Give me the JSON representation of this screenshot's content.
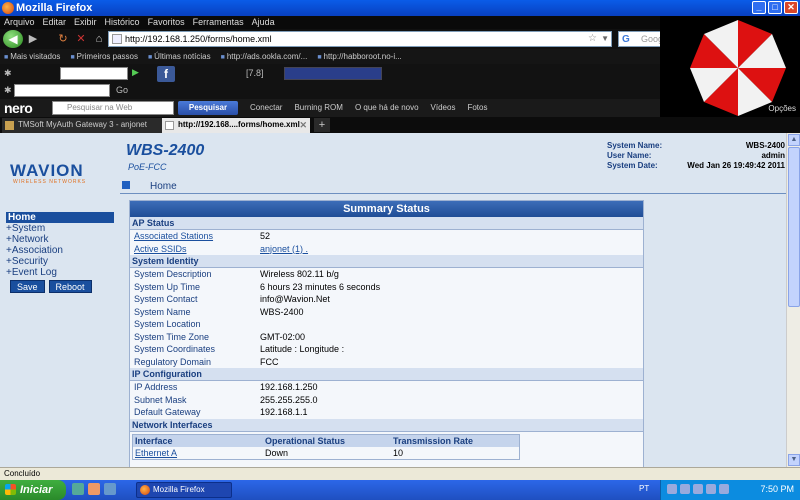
{
  "window": {
    "title": "Mozilla Firefox"
  },
  "menu": [
    "Arquivo",
    "Editar",
    "Exibir",
    "Histórico",
    "Favoritos",
    "Ferramentas",
    "Ajuda"
  ],
  "nav": {
    "url": "http://192.168.1.250/forms/home.xml",
    "search_placeholder": "Google"
  },
  "bookmarks": [
    "Mais visitados",
    "Primeiros passos",
    "Últimas notícias",
    "http://ads.ookla.com/...",
    "http://habboroot.no-i..."
  ],
  "toolbar2": {
    "go_label": "Go",
    "counter": "[7.8]"
  },
  "nero": {
    "logo": "nero",
    "search_placeholder": "Pesquisar na Web",
    "search_button": "Pesquisar",
    "items": [
      "Conectar",
      "Burning ROM",
      "O que há de novo",
      "Vídeos",
      "Fotos"
    ]
  },
  "opcoes": "Opções",
  "tabs": [
    {
      "label": "TMSoft MyAuth Gateway 3 - anjonet"
    },
    {
      "label": "http://192.168....forms/home.xml"
    }
  ],
  "page": {
    "brand": "WAVION",
    "brand_sub": "WIRELESS NETWORKS",
    "device": "WBS-2400",
    "device_sub": "PoE-FCC",
    "home_link": "Home",
    "sysinfo": [
      {
        "k": "System Name:",
        "v": "WBS-2400"
      },
      {
        "k": "User Name:",
        "v": "admin"
      },
      {
        "k": "System Date:",
        "v": "Wed Jan 26 19:49:42 2011"
      }
    ],
    "sidenav": [
      "Home",
      "+System",
      "+Network",
      "+Association",
      "+Security",
      "+Event Log"
    ],
    "buttons": {
      "save": "Save",
      "reboot": "Reboot"
    },
    "panel_title": "Summary Status",
    "ap_status": {
      "title": "AP Status",
      "rows": [
        {
          "k": "Associated Stations",
          "v": "52"
        },
        {
          "k": "Active SSIDs",
          "v": "anjonet (1) ."
        }
      ]
    },
    "identity": {
      "title": "System Identity",
      "rows": [
        {
          "k": "System Description",
          "v": "Wireless 802.11 b/g"
        },
        {
          "k": "System Up Time",
          "v": "6 hours 23 minutes 6 seconds"
        },
        {
          "k": "System Contact",
          "v": "info@Wavion.Net"
        },
        {
          "k": "System Name",
          "v": "WBS-2400"
        },
        {
          "k": "System Location",
          "v": ""
        },
        {
          "k": "System Time Zone",
          "v": "GMT-02:00"
        },
        {
          "k": "System Coordinates",
          "v": "Latitude : Longitude :"
        },
        {
          "k": "Regulatory Domain",
          "v": "FCC"
        }
      ]
    },
    "ip": {
      "title": "IP Configuration",
      "rows": [
        {
          "k": "IP Address",
          "v": "192.168.1.250"
        },
        {
          "k": "Subnet Mask",
          "v": "255.255.255.0"
        },
        {
          "k": "Default Gateway",
          "v": "192.168.1.1"
        }
      ]
    },
    "net": {
      "title": "Network Interfaces",
      "headers": [
        "Interface",
        "Operational Status",
        "Transmission Rate"
      ],
      "rows": [
        [
          "Ethernet A",
          "Down",
          "10"
        ]
      ]
    }
  },
  "status": "Concluído",
  "taskbar": {
    "start": "Iniciar",
    "item": "Mozilla Firefox",
    "lang": "PT",
    "clock": "7:50 PM"
  }
}
